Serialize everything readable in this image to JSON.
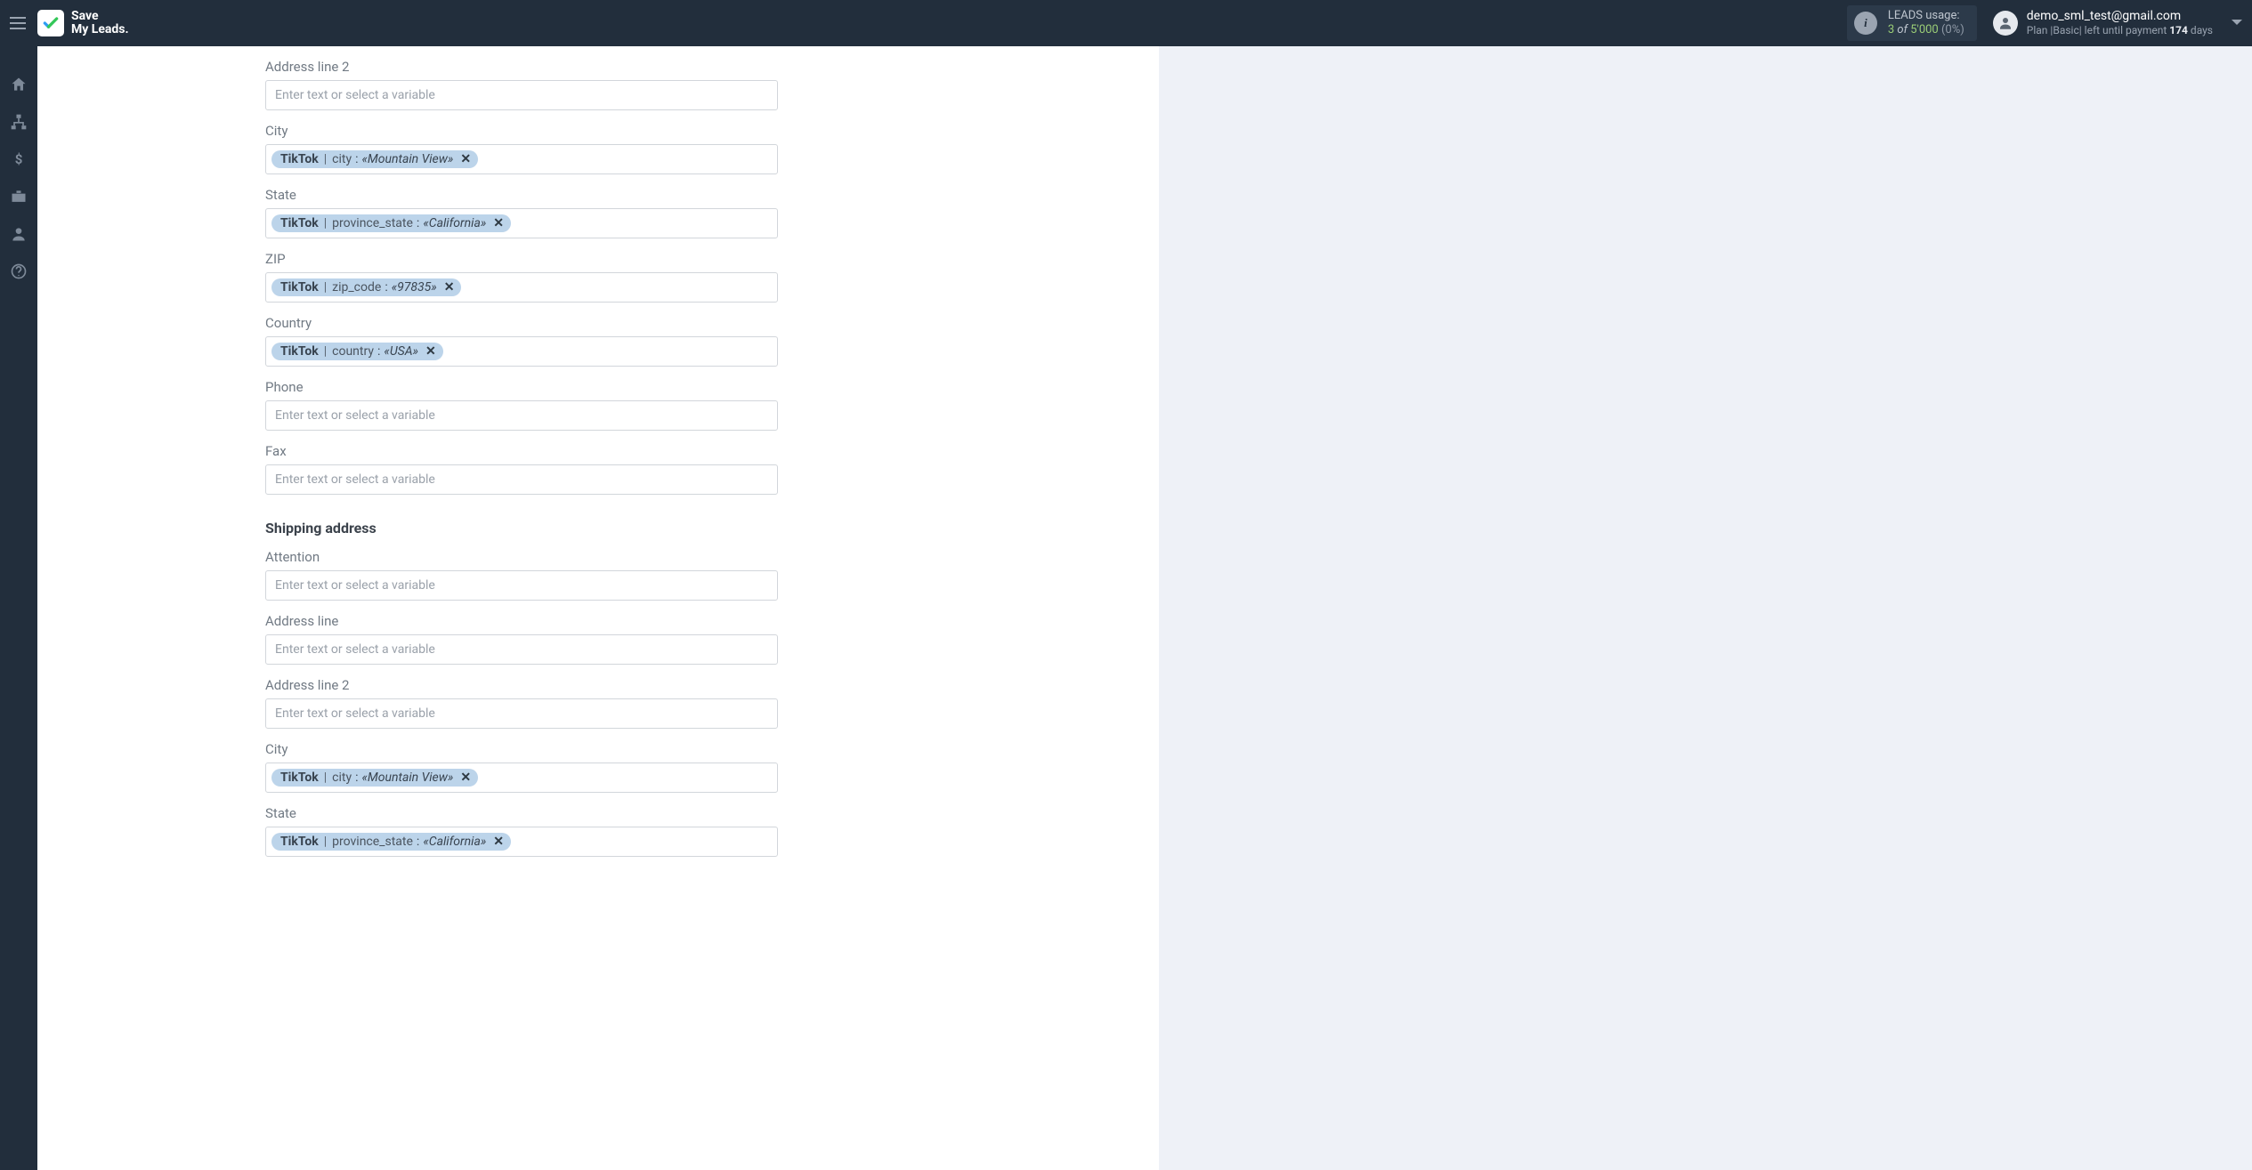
{
  "header": {
    "brand_line1": "Save",
    "brand_line2": "My Leads.",
    "usage_label": "LEADS usage:",
    "usage_count": "3",
    "usage_of": "of",
    "usage_total": "5'000",
    "usage_pct": "(0%)",
    "account_email": "demo_sml_test@gmail.com",
    "plan_prefix": "Plan |",
    "plan_name": "Basic",
    "plan_mid": "| left until payment",
    "plan_days": "174",
    "plan_days_suffix": "days"
  },
  "placeholder": "Enter text or select a variable",
  "chip_source": "TikTok",
  "fields": {
    "addr2": {
      "label": "Address line 2"
    },
    "city": {
      "label": "City",
      "key": "city",
      "value": "«Mountain View»"
    },
    "state": {
      "label": "State",
      "key": "province_state",
      "value": "«California»"
    },
    "zip": {
      "label": "ZIP",
      "key": "zip_code",
      "value": "«97835»"
    },
    "country": {
      "label": "Country",
      "key": "country",
      "value": "«USA»"
    },
    "phone": {
      "label": "Phone"
    },
    "fax": {
      "label": "Fax"
    }
  },
  "shipping": {
    "section_title": "Shipping address",
    "attention": {
      "label": "Attention"
    },
    "addr": {
      "label": "Address line"
    },
    "addr2": {
      "label": "Address line 2"
    },
    "city": {
      "label": "City",
      "key": "city",
      "value": "«Mountain View»"
    },
    "state": {
      "label": "State",
      "key": "province_state",
      "value": "«California»"
    }
  }
}
